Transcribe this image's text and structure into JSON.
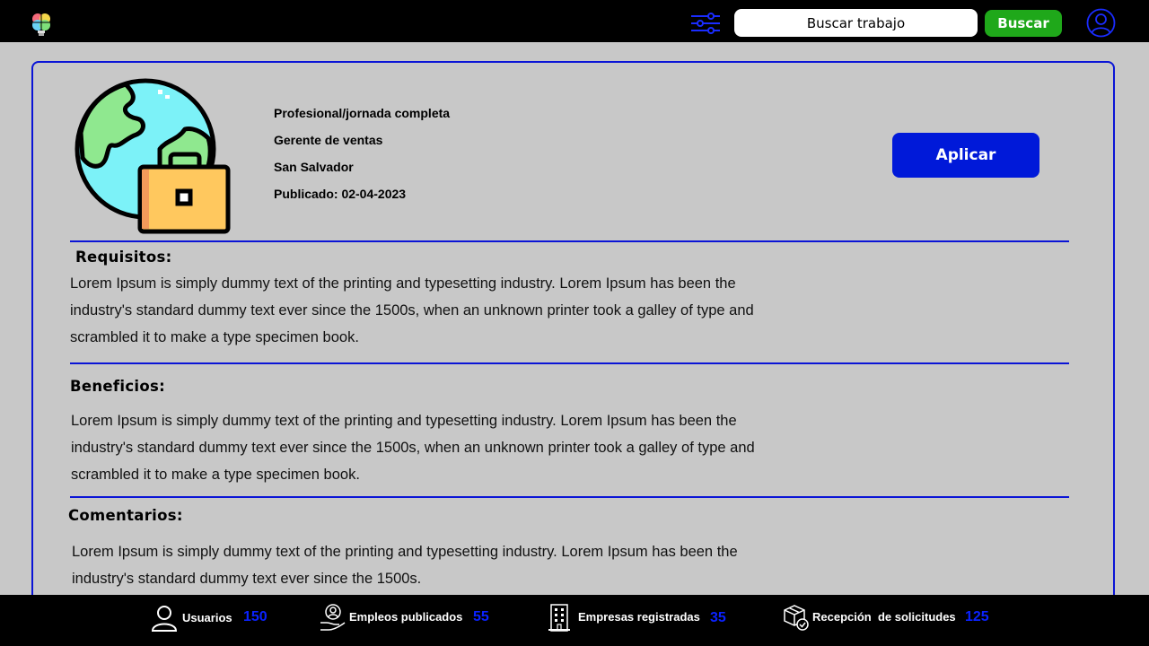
{
  "header": {
    "search_placeholder": "Buscar trabajo",
    "search_button": "Buscar",
    "logo_icon": "lightbulb-puzzle-logo",
    "filter_icon": "sliders-icon",
    "profile_icon": "user-circle-icon"
  },
  "job": {
    "type": "Profesional/jornada completa",
    "title": "Gerente de ventas",
    "location": "San Salvador",
    "published": "Publicado: 02-04-2023",
    "apply_label": "Aplicar",
    "illustration_icon": "globe-briefcase-icon"
  },
  "sections": {
    "requirements": {
      "title": "Requisitos:",
      "body": "Lorem Ipsum is simply dummy text of the printing and typesetting industry. Lorem Ipsum has been the industry's standard dummy text ever since the 1500s, when an unknown printer took a galley of type and scrambled it to make a type specimen book."
    },
    "benefits": {
      "title": "Beneficios:",
      "body": "Lorem Ipsum is simply dummy text of the printing and typesetting industry. Lorem Ipsum has been the industry's standard dummy text ever since the 1500s, when an unknown printer took a galley of type and scrambled it to make a type specimen book."
    },
    "comments": {
      "title": "Comentarios:",
      "body": "Lorem Ipsum is simply dummy text of the printing and typesetting industry. Lorem Ipsum has been the industry's standard dummy text ever since the 1500s."
    }
  },
  "footer": {
    "stats": [
      {
        "label": "Usuarios",
        "value": "150",
        "icon": "user-icon"
      },
      {
        "label": "Empleos publicados",
        "value": "55",
        "icon": "hand-person-icon"
      },
      {
        "label": "Empresas registradas",
        "value": "35",
        "icon": "building-icon"
      },
      {
        "label": "Recepción  de solicitudes",
        "value": "125",
        "icon": "package-check-icon"
      }
    ]
  },
  "colors": {
    "accent_blue": "#0019d9",
    "border_blue": "#0a14d6",
    "search_green": "#1fa81a",
    "background": "#c8c8c8",
    "bar": "#000000"
  }
}
